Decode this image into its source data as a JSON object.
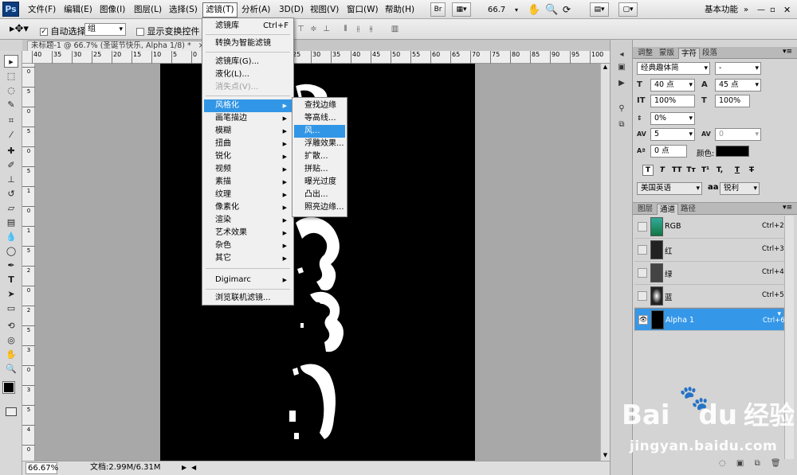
{
  "menubar": {
    "logo": "Ps",
    "items": [
      "文件(F)",
      "编辑(E)",
      "图像(I)",
      "图层(L)",
      "选择(S)",
      "滤镜(T)",
      "分析(A)",
      "3D(D)",
      "视图(V)",
      "窗口(W)",
      "帮助(H)"
    ],
    "bridge_btn": "Br",
    "zoom": "66.7",
    "workspace": "基本功能"
  },
  "options": {
    "auto_select_label": "自动选择:",
    "auto_select_checked": "✓",
    "auto_select_value": "组",
    "show_transform_label": "显示变换控件"
  },
  "document": {
    "tab_title": "未标题-1 @ 66.7% (圣诞节快乐, Alpha 1/8) *",
    "close": "×",
    "zoom_status": "66.67%",
    "doc_info": "文档:2.99M/6.31M"
  },
  "ruler": {
    "h_labels": [
      "40",
      "35",
      "30",
      "25",
      "20",
      "15",
      "10",
      "5",
      "0",
      "5",
      "10",
      "15",
      "20",
      "25",
      "30",
      "35",
      "40",
      "45",
      "50",
      "55",
      "60",
      "65",
      "70",
      "75",
      "80",
      "85",
      "90",
      "95",
      "100"
    ],
    "v_labels": [
      "0",
      "5",
      "0",
      "5",
      "0",
      "5",
      "1",
      "0",
      "1",
      "5",
      "2",
      "0",
      "2",
      "5",
      "3",
      "0",
      "3",
      "5",
      "4",
      "0"
    ]
  },
  "filter_menu": {
    "items": [
      {
        "label": "滤镜库",
        "shortcut": "Ctrl+F"
      },
      {
        "label": "转换为智能滤镜"
      },
      {
        "label": "滤镜库(G)..."
      },
      {
        "label": "液化(L)..."
      },
      {
        "label": "消失点(V)...",
        "disabled": true
      },
      {
        "label": "风格化",
        "highlighted": true
      },
      {
        "label": "画笔描边"
      },
      {
        "label": "模糊"
      },
      {
        "label": "扭曲"
      },
      {
        "label": "锐化"
      },
      {
        "label": "视频"
      },
      {
        "label": "素描"
      },
      {
        "label": "纹理"
      },
      {
        "label": "像素化"
      },
      {
        "label": "渲染"
      },
      {
        "label": "艺术效果"
      },
      {
        "label": "杂色"
      },
      {
        "label": "其它"
      },
      {
        "label": "Digimarc"
      },
      {
        "label": "浏览联机滤镜..."
      }
    ]
  },
  "stylize_submenu": {
    "items": [
      "查找边缘",
      "等高线...",
      "风...",
      "浮雕效果...",
      "扩散...",
      "拼贴...",
      "曝光过度",
      "凸出...",
      "照亮边缘..."
    ],
    "highlighted_index": 2
  },
  "char_panel": {
    "tabs": [
      "调整",
      "蒙版",
      "字符",
      "段落"
    ],
    "active_tab": "字符",
    "font_family": "经典趣体简",
    "font_style": "-",
    "font_size": "40 点",
    "leading": "45 点",
    "vscale": "100%",
    "hscale": "100%",
    "baseline": "0%",
    "kerning": "5",
    "tracking": "0",
    "shift": "0 点",
    "color_label": "颜色:",
    "text_color": "#000000",
    "style_btns": [
      "T",
      "T",
      "TT",
      "Tт",
      "T¹",
      "T,",
      "T",
      "T"
    ],
    "language": "美国英语",
    "aa_icon": "aa",
    "antialias": "锐利"
  },
  "channels_panel": {
    "tabs": [
      "图层",
      "通道",
      "路径"
    ],
    "active_tab": "通道",
    "rows": [
      {
        "name": "RGB",
        "shortcut": "Ctrl+2"
      },
      {
        "name": "红",
        "shortcut": "Ctrl+3"
      },
      {
        "name": "绿",
        "shortcut": "Ctrl+4"
      },
      {
        "name": "蓝",
        "shortcut": "Ctrl+5"
      },
      {
        "name": "Alpha 1",
        "shortcut": "Ctrl+6"
      }
    ],
    "selected_row": 4
  },
  "watermark": {
    "brand": "Bai",
    "brand2": "du",
    "brand_cn": "经验",
    "url": "jingyan.baidu.com"
  },
  "colors": {
    "accent": "#3296e6",
    "document_bg": "#000000",
    "canvas_bg": "#a8a8a8"
  }
}
